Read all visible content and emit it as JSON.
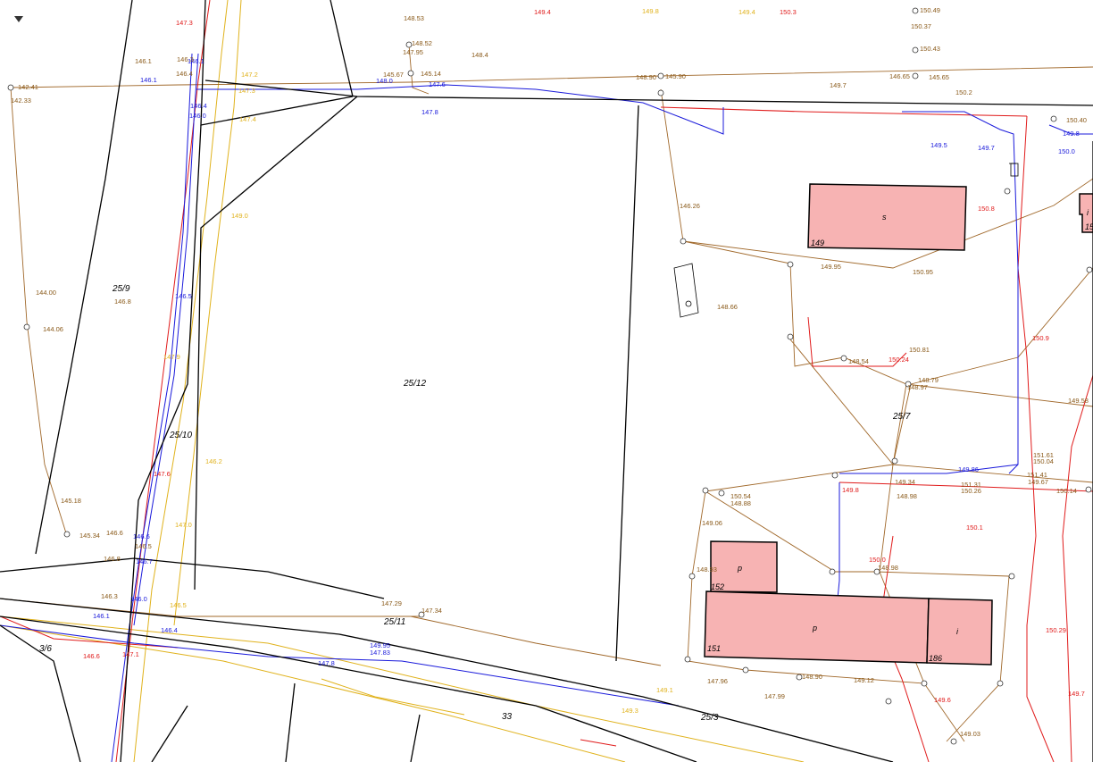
{
  "controls": {
    "menu_toggle": "dropdown-arrow"
  },
  "colors": {
    "boundary": "#000000",
    "water": "#1a1adb",
    "power": "#e01b1b",
    "gas": "#e0b21c",
    "sewer": "#8a5a1a",
    "building_fill": "#f7b3b3"
  },
  "parcels": [
    "25/9",
    "25/12",
    "25/10",
    "25/11",
    "25/7",
    "3/6",
    "33",
    "25/3"
  ],
  "buildings": [
    {
      "type": "s",
      "floors": "149"
    },
    {
      "type": "p",
      "floors": "152"
    },
    {
      "type": "p",
      "floors": "151"
    },
    {
      "type": "i",
      "floors": "186"
    },
    {
      "type": "i",
      "floors": "15"
    }
  ],
  "heights": {
    "blue": [
      "146.1",
      "146.1",
      "147.6",
      "147.8",
      "149.8",
      "146.0",
      "146.5",
      "146.6",
      "146.7",
      "146.0",
      "146.1",
      "146.4",
      "147.8",
      "149.95",
      "147.83",
      "148.0",
      "149.5",
      "149.7",
      "150.0",
      "149.86",
      "146.4"
    ],
    "red": [
      "147.3",
      "149.4",
      "150.3",
      "147.6",
      "150.8",
      "150.9",
      "150.24",
      "149.8",
      "150.1",
      "150.0",
      "150.29",
      "149.7",
      "146.6",
      "147.1",
      "149.6"
    ],
    "yellow": [
      "149.8",
      "149.4",
      "147.2",
      "147.3",
      "147.4",
      "149.0",
      "147.9",
      "146.2",
      "147.0",
      "146.5",
      "149.1",
      "149.3"
    ],
    "brown": [
      "148.53",
      "148.52",
      "147.95",
      "148.4",
      "150.49",
      "150.37",
      "150.43",
      "145.67",
      "145.14",
      "148.90",
      "145.90",
      "149.7",
      "146.65",
      "145.65",
      "150.2",
      "146.1",
      "146.3",
      "146.4",
      "142.41",
      "142.33",
      "144.00",
      "144.06",
      "146.8",
      "145.18",
      "145.34",
      "146.6",
      "146.5",
      "146.8",
      "146.3",
      "147.29",
      "147.34",
      "146.26",
      "149.58",
      "150.40",
      "150.95",
      "149.95",
      "148.66",
      "150.81",
      "148.54",
      "148.79",
      "148.97",
      "149.34",
      "148.98",
      "150.54",
      "148.88",
      "149.06",
      "151.61",
      "150.04",
      "151.41",
      "149.67",
      "151.31",
      "150.26",
      "150.14",
      "148.90",
      "149.12",
      "147.96",
      "147.99",
      "149.03",
      "148.93",
      "148.98"
    ]
  }
}
